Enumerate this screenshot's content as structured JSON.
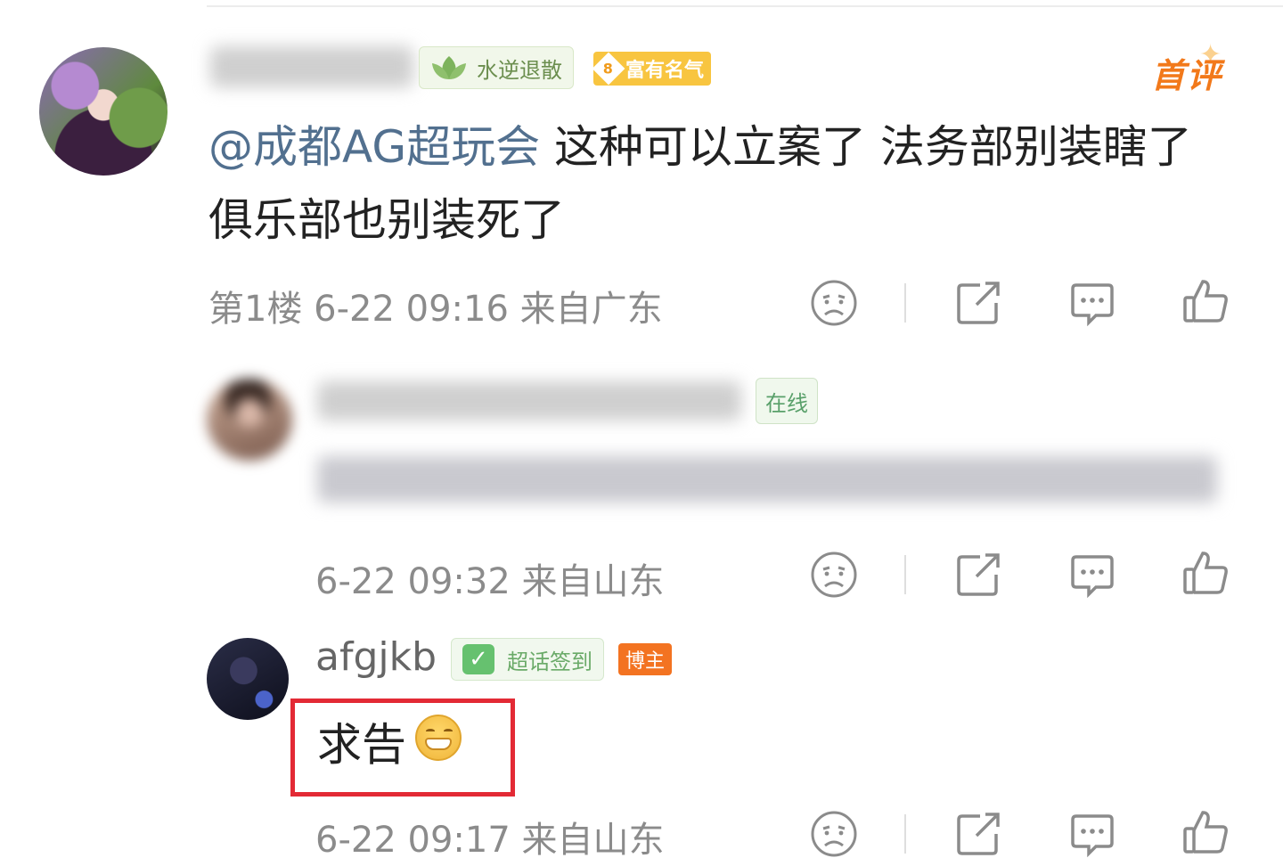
{
  "first_comment": {
    "badge_water": "水逆退散",
    "badge_level": "8",
    "badge_fame": "富有名气",
    "tag": "首评",
    "mention": "@成都AG超玩会",
    "text": " 这种可以立案了 法务部别装瞎了 俱乐部也别装死了",
    "meta": "第1楼  6-22 09:16  来自广东"
  },
  "reply_blurred": {
    "badge_online": "在线",
    "meta": "6-22 09:32  来自山东"
  },
  "reply_afgjkb": {
    "name": "afgjkb",
    "badge_checkin": "超话签到",
    "badge_blogger": "博主",
    "text": "求告",
    "meta": "6-22 09:17  来自山东"
  },
  "actions": [
    "dislike-icon",
    "share-icon",
    "comment-icon",
    "like-icon"
  ],
  "colors": {
    "highlight_box": "#e32a35",
    "mention": "#52708f",
    "first_comment_tag": "#f2791a",
    "meta_text": "#8b8b8b"
  }
}
